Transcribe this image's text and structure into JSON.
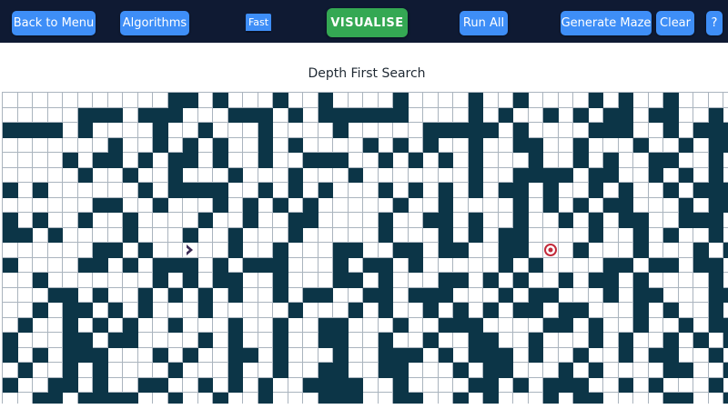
{
  "navbar": {
    "back_label": "Back to Menu",
    "algorithms_label": "Algorithms",
    "speed_label": "Fast",
    "visualise_label": "VISUALISE",
    "run_all_label": "Run All",
    "generate_maze_label": "Generate Maze",
    "clear_label": "Clear",
    "help_label": "?"
  },
  "board": {
    "title": "Depth First Search",
    "cols": 49,
    "rows": 21,
    "start": {
      "row": 10,
      "col": 12
    },
    "target": {
      "row": 10,
      "col": 36
    },
    "walls": [
      "...........00.0...0..0....0....0..0....0.0..0...",
      ".....000.000...000.0.000000....0.0..0.0.00.00..0.",
      "0000.0....0..0...0....0.....00000.0....000..0.000",
      ".......0..0.0.0..0.0....0.0.0..0..00..0...0..0.00",
      "....0.00.0.00.0..0..000..0.0.0.0...0..0.0..00..0.",
      ".....0..0..0...0...0...0.......0..0000.00..0.0.0.",
      "0.0......0.0000..0.0.0...0.0.0.0.00.0..0.0..0.000",
      "......00..0...0.0.0.0.....0..0....0.0.0.00...0.00",
      "0.0..0..0....0..0..00....0..00.0..0..0.0.00..000.",
      "00.0....0...0..0...0.....0...0.0.00....0..0.0..0.",
      "......00.0.....0..0...00..00.00..00.0.0...0...0.0",
      "0....00.0.000.0.000...0.00.0.....0.0....00.00.00.",
      "..0.......0.0.00..0...00.0...00.0.0..0.00.0....0.",
      "...00.0..0.0.0.0..0.00..00.000...0.00...0.00...00",
      "..0.00.0.0...0.....0...0.0..0.0.0.00.00...0.0..0.",
      ".0..0.0.0..0...0..0..00...0..000....00.0..0..0.00",
      "0...00.00....0.0..0..00..0..0..00..0...0.0..0.0.0",
      "0.0.000...0.0..00.0...0..000.0.000.0..0..0.00..0.",
      ".0..0.0....0...0..0..00..00...0.00...0.0....00..0",
      "0..00.0..00..0.0.0..0000..0....00.0.000..0.0...0.",
      "..00.0000..0..0..0...000..00..0.0...0.00....00..0"
    ]
  },
  "colors": {
    "navbar_bg": "#0f1a33",
    "button_blue": "#3e8ef7",
    "visualise_green": "#34a853",
    "wall": "#0c3547",
    "grid_line": "#aab4be",
    "start_marker": "#3b2a55",
    "target_marker": "#c22a3a"
  },
  "icons": {
    "start": "chevron-right-icon",
    "target": "target-icon"
  }
}
